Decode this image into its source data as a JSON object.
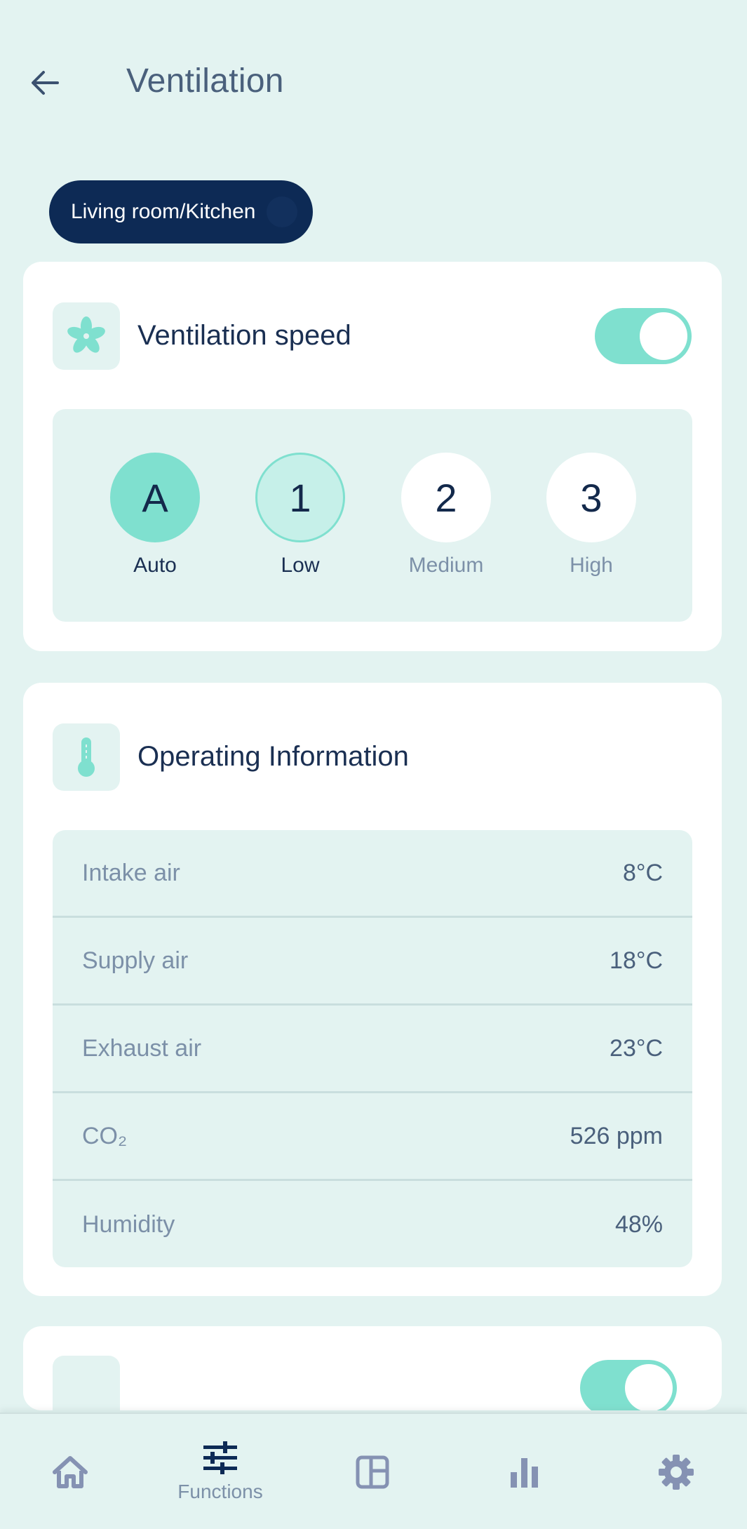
{
  "header": {
    "title": "Ventilation",
    "back_icon": "arrow-left-icon"
  },
  "room_selector": {
    "label": "Living room/Kitchen"
  },
  "ventilation_speed": {
    "title": "Ventilation speed",
    "icon": "fan-icon",
    "enabled": true,
    "options": [
      {
        "symbol": "A",
        "label": "Auto",
        "state": "active"
      },
      {
        "symbol": "1",
        "label": "Low",
        "state": "selected"
      },
      {
        "symbol": "2",
        "label": "Medium",
        "state": "normal"
      },
      {
        "symbol": "3",
        "label": "High",
        "state": "normal"
      }
    ]
  },
  "operating_info": {
    "title": "Operating Information",
    "icon": "thermometer-icon",
    "rows": [
      {
        "label": "Intake air",
        "value": "8°C"
      },
      {
        "label": "Supply air",
        "value": "18°C"
      },
      {
        "label": "Exhaust air",
        "value": "23°C"
      },
      {
        "label": "CO₂",
        "value": "526 ppm"
      },
      {
        "label": "Humidity",
        "value": "48%"
      }
    ]
  },
  "next_card": {
    "title": "",
    "enabled": true
  },
  "bottom_nav": {
    "items": [
      {
        "name": "home",
        "icon": "home-icon",
        "label": ""
      },
      {
        "name": "functions",
        "icon": "sliders-icon",
        "label": "Functions"
      },
      {
        "name": "layout",
        "icon": "layout-icon",
        "label": ""
      },
      {
        "name": "statistics",
        "icon": "bar-chart-icon",
        "label": ""
      },
      {
        "name": "settings",
        "icon": "gear-icon",
        "label": ""
      }
    ]
  },
  "colors": {
    "background": "#e3f3f1",
    "accent": "#7fe0cf",
    "navy": "#0d2a55",
    "text_muted": "#7c90a8"
  }
}
